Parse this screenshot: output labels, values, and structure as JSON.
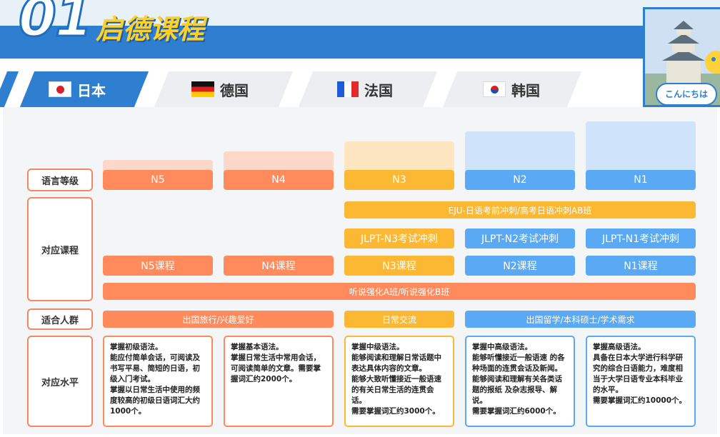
{
  "header": {
    "number": "01",
    "title": "启德课程",
    "greeting": "こんにちは"
  },
  "tabs": [
    {
      "label": "日本",
      "flag": "japan-flag-icon",
      "active": true
    },
    {
      "label": "德国",
      "flag": "germany-flag-icon",
      "active": false
    },
    {
      "label": "法国",
      "flag": "france-flag-icon",
      "active": false
    },
    {
      "label": "韩国",
      "flag": "korea-flag-icon",
      "active": false
    }
  ],
  "row_labels": {
    "level": "语言等级",
    "courses": "对应课程",
    "audience": "适合人群",
    "ability": "对应水平"
  },
  "levels": [
    "N5",
    "N4",
    "N3",
    "N2",
    "N1"
  ],
  "courses": {
    "eju": "EJU-日语考前冲刺/高考日语冲刺AB班",
    "jlpt": [
      "JLPT-N3考试冲刺",
      "JLPT-N2考试冲刺",
      "JLPT-N1考试冲刺"
    ],
    "level_courses": [
      "N5课程",
      "N4课程",
      "N3课程",
      "N2课程",
      "N1课程"
    ],
    "listening": "听说强化A班/听说强化B班"
  },
  "audience": [
    "出国旅行/兴趣爱好",
    "日常交流",
    "出国留学/本科硕士/学术需求"
  ],
  "ability": [
    "掌握初级语法。\n能应付简单会话，可阅读及书写平易、简短的日语，初级入门考试。\n掌握以日常生活中使用的频度较高的初级日语词汇大约1000个。",
    "掌握基本语法。\n掌握日常生活中常用会话，可阅读简单的文章。需要掌握词汇约2000个。",
    "掌握中级语法。\n能够阅读和理解日常话题中表达具体内容的文章。\n能够大致听懂接近一般语速的有关日常生活的连贯会话。\n需要掌握词汇约3000个。",
    "掌握中高级语法。\n能够听懂接近一般语速 的各种场面的连贯会话及新闻。能够阅读和理解有关各类话题的报纸 及杂志报导、解说。\n需要掌握词汇约6000个。",
    "掌握高级语法。\n具备在日本大学进行科学研究的综合日语能力，难度相当于大学日语专业本科毕业的水平。\n需要掌握词汇约10000个。"
  ],
  "colors": {
    "brand_blue": "#2e7fd0",
    "orange": "#ff8a5c",
    "yellow": "#fdb833",
    "blue": "#5aa9f5",
    "title_yellow": "#ffd02a"
  }
}
